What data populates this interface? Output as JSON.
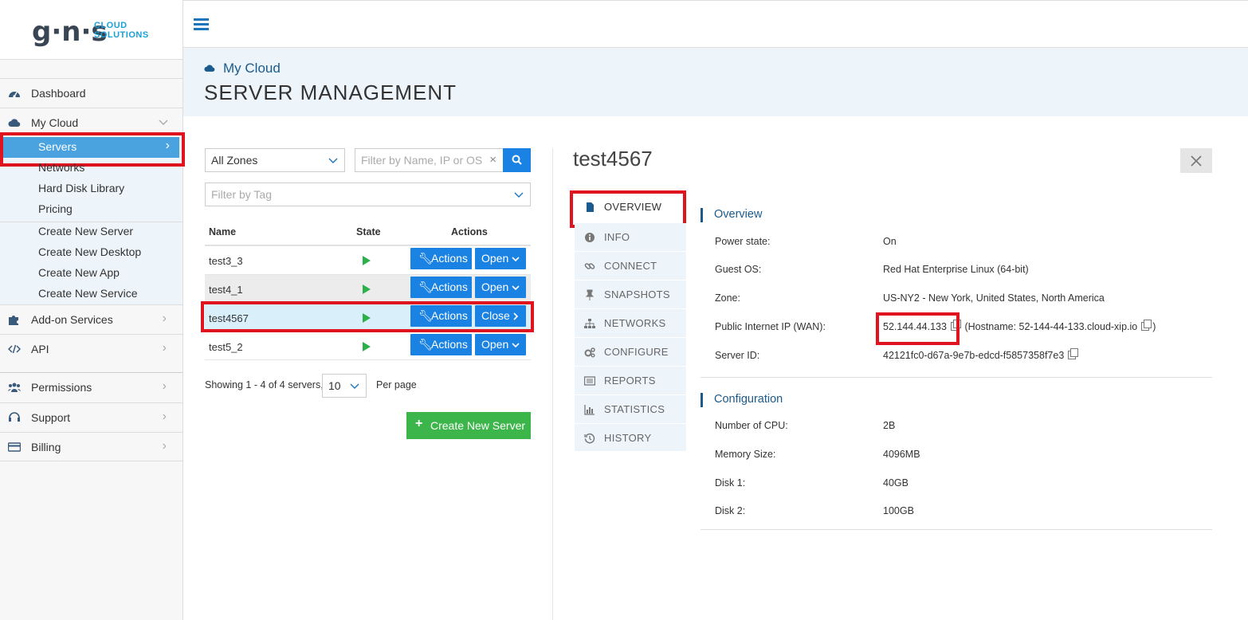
{
  "brand": {
    "mark": "g·n·s",
    "line1": "CLOUD",
    "line2": "SOLUTIONS"
  },
  "sidebar": {
    "items": [
      {
        "label": "Dashboard",
        "icon": "dashboard-icon"
      },
      {
        "label": "My Cloud",
        "icon": "cloud-icon"
      },
      {
        "label": "Add-on Services",
        "icon": "puzzle-icon"
      },
      {
        "label": "API",
        "icon": "code-icon"
      },
      {
        "label": "Permissions",
        "icon": "users-icon"
      },
      {
        "label": "Support",
        "icon": "headset-icon"
      },
      {
        "label": "Billing",
        "icon": "credit-card-icon"
      }
    ],
    "cloud_sub": [
      "Servers",
      "Networks",
      "Hard Disk Library",
      "Pricing"
    ],
    "create_sub": [
      "Create New Server",
      "Create New Desktop",
      "Create New App",
      "Create New Service"
    ]
  },
  "header": {
    "breadcrumb": "My Cloud",
    "title": "SERVER MANAGEMENT"
  },
  "filters": {
    "zone": "All Zones",
    "search_placeholder": "Filter by Name, IP or OS",
    "tag_placeholder": "Filter by Tag",
    "clear": "×"
  },
  "table": {
    "headers": [
      "Name",
      "State",
      "Actions"
    ],
    "rows": [
      {
        "name": "test3_3",
        "actions": "Actions",
        "toggle": "Open"
      },
      {
        "name": "test4_1",
        "actions": "Actions",
        "toggle": "Open"
      },
      {
        "name": "test4567",
        "actions": "Actions",
        "toggle": "Close"
      },
      {
        "name": "test5_2",
        "actions": "Actions",
        "toggle": "Open"
      }
    ]
  },
  "pagination": {
    "showing": "Showing 1 - 4 of 4 servers,",
    "per_page_value": "10",
    "per_page_label": "Per page"
  },
  "create_button": "Create New Server",
  "detail": {
    "server_name": "test4567",
    "tabs": [
      "OVERVIEW",
      "INFO",
      "CONNECT",
      "SNAPSHOTS",
      "NETWORKS",
      "CONFIGURE",
      "REPORTS",
      "STATISTICS",
      "HISTORY"
    ],
    "overview_title": "Overview",
    "overview": [
      {
        "k": "Power state:",
        "v": "On"
      },
      {
        "k": "Guest OS:",
        "v": "Red Hat Enterprise Linux (64-bit)"
      },
      {
        "k": "Zone:",
        "v": "US-NY2 - New York, United States, North America"
      },
      {
        "k": "Public Internet IP (WAN):",
        "v": "52.144.44.133"
      },
      {
        "k": "Server ID:",
        "v": "42121fc0-d67a-9e7b-edcd-f5857358f7e3"
      }
    ],
    "hostname_prefix": "(Hostname: ",
    "hostname": "52-144-44-133.cloud-xip.io",
    "hostname_suffix": ")",
    "config_title": "Configuration",
    "config": [
      {
        "k": "Number of CPU:",
        "v": "2B"
      },
      {
        "k": "Memory Size:",
        "v": "4096MB"
      },
      {
        "k": "Disk 1:",
        "v": "40GB"
      },
      {
        "k": "Disk 2:",
        "v": "100GB"
      }
    ]
  }
}
